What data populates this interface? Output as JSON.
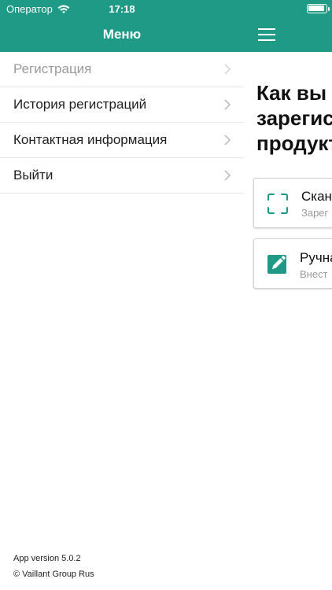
{
  "status_bar": {
    "carrier": "Оператор",
    "time": "17:18"
  },
  "drawer": {
    "title": "Меню",
    "items": [
      {
        "label": "Регистрация",
        "disabled": true
      },
      {
        "label": "История регистраций",
        "disabled": false
      },
      {
        "label": "Контактная информация",
        "disabled": false
      },
      {
        "label": "Выйти",
        "disabled": false
      }
    ],
    "footer": {
      "version": "App version 5.0.2",
      "copyright": "© Vaillant Group Rus"
    }
  },
  "main": {
    "headline_lines": [
      "Как вы х",
      "зарегис",
      "продукт"
    ],
    "options": [
      {
        "title": "Скан",
        "subtitle": "Зарег",
        "icon": "scan-frame-icon"
      },
      {
        "title": "Ручна",
        "subtitle": "Внест",
        "icon": "edit-icon"
      }
    ]
  },
  "colors": {
    "accent": "#1f9a86",
    "disabled_text": "#9a9a9a"
  }
}
